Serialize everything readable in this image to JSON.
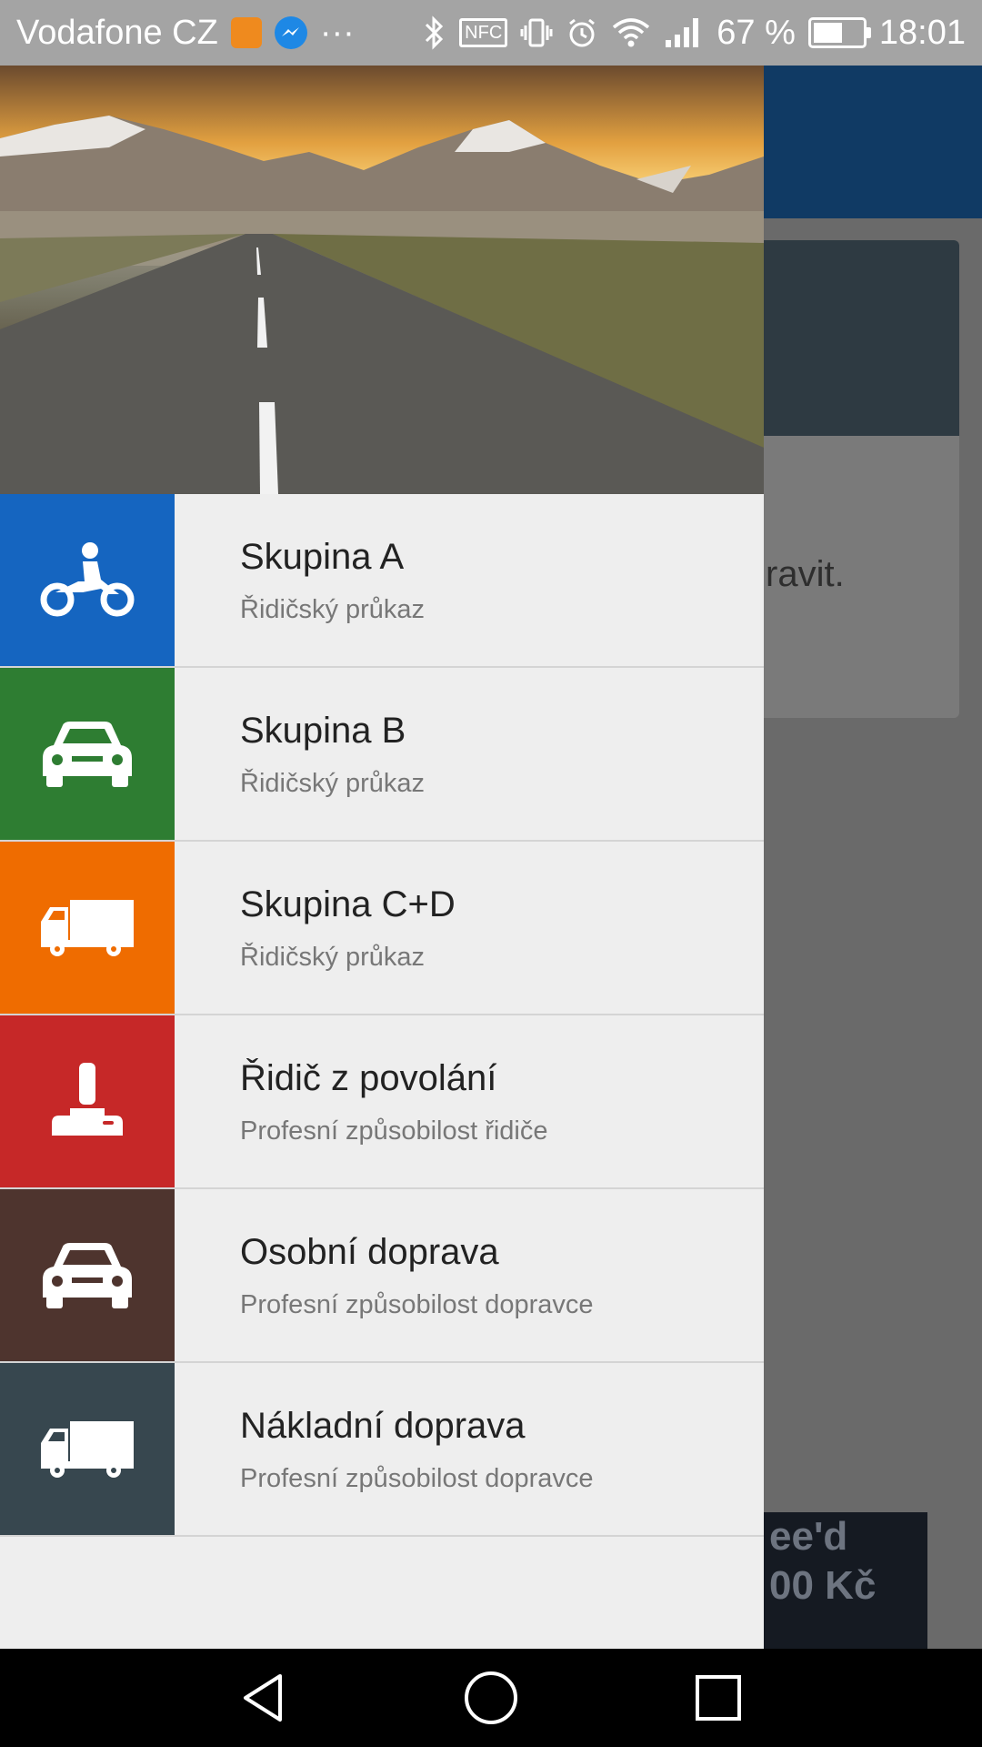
{
  "status_bar": {
    "carrier": "Vodafone CZ",
    "overflow": "···",
    "nfc": "NFC",
    "battery_percent": "67 %",
    "battery_level": 0.67,
    "time": "18:01",
    "icons": [
      "notification-app-icon",
      "messenger-icon",
      "bluetooth-icon",
      "nfc-icon",
      "vibrate-icon",
      "alarm-icon",
      "wifi-icon",
      "signal-icon",
      "battery-icon"
    ]
  },
  "background_app": {
    "card_text": "ravit.",
    "ad_line1": "ee'd",
    "ad_line2": "00 Kč"
  },
  "drawer": {
    "header_image": "road-mountains-sunset",
    "items": [
      {
        "title": "Skupina A",
        "subtitle": "Řidičský průkaz",
        "color": "#1565c0",
        "icon": "motorcycle-icon"
      },
      {
        "title": "Skupina B",
        "subtitle": "Řidičský průkaz",
        "color": "#2e7d32",
        "icon": "car-icon"
      },
      {
        "title": "Skupina C+D",
        "subtitle": "Řidičský průkaz",
        "color": "#ef6c00",
        "icon": "truck-icon"
      },
      {
        "title": "Řidič z povolání",
        "subtitle": "Profesní způsobilost řidiče",
        "color": "#c62828",
        "icon": "joystick-icon"
      },
      {
        "title": "Osobní doprava",
        "subtitle": "Profesní způsobilost dopravce",
        "color": "#4e342e",
        "icon": "car-icon"
      },
      {
        "title": "Nákladní doprava",
        "subtitle": "Profesní způsobilost dopravce",
        "color": "#37474f",
        "icon": "truck-icon"
      }
    ]
  },
  "nav_bar": {
    "buttons": [
      "back-icon",
      "home-icon",
      "recents-icon"
    ]
  }
}
